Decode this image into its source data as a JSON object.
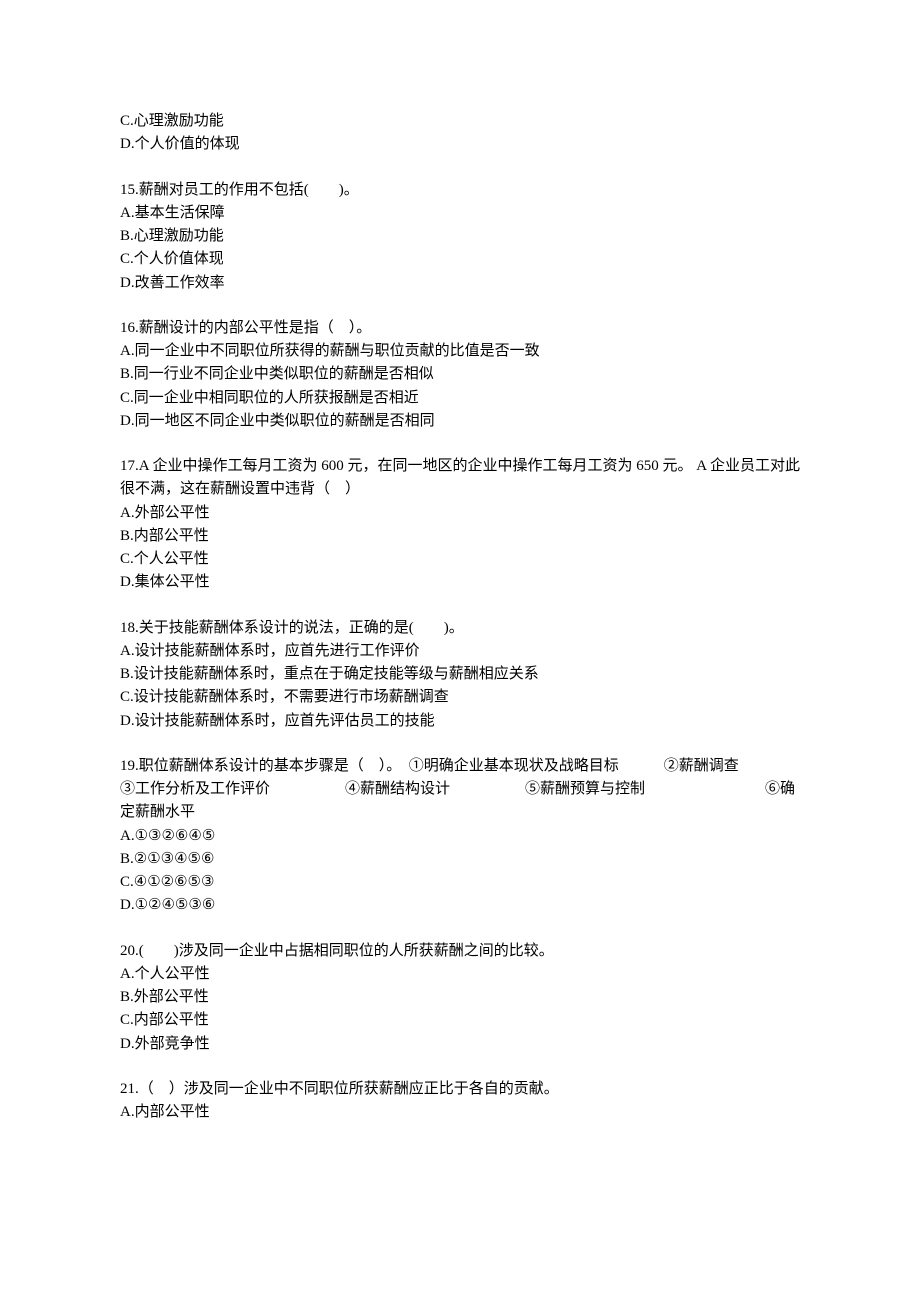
{
  "orphan": {
    "c": "C.心理激励功能",
    "d": "D.个人价值的体现"
  },
  "q15": {
    "stem": "15.薪酬对员工的作用不包括(　　)。",
    "a": "A.基本生活保障",
    "b": "B.心理激励功能",
    "c": "C.个人价值体现",
    "d": "D.改善工作效率"
  },
  "q16": {
    "stem": "16.薪酬设计的内部公平性是指（　）。",
    "a": "A.同一企业中不同职位所获得的薪酬与职位贡献的比值是否一致",
    "b": "B.同一行业不同企业中类似职位的薪酬是否相似",
    "c": "C.同一企业中相同职位的人所获报酬是否相近",
    "d": "D.同一地区不同企业中类似职位的薪酬是否相同"
  },
  "q17": {
    "stem": "17.A 企业中操作工每月工资为 600 元，在同一地区的企业中操作工每月工资为 650 元。 A 企业员工对此很不满，这在薪酬设置中违背（　）",
    "a": "A.外部公平性",
    "b": "B.内部公平性",
    "c": "C.个人公平性",
    "d": "D.集体公平性"
  },
  "q18": {
    "stem": "18.关于技能薪酬体系设计的说法，正确的是(　　)。",
    "a": "A.设计技能薪酬体系时，应首先进行工作评价",
    "b": "B.设计技能薪酬体系时，重点在于确定技能等级与薪酬相应关系",
    "c": "C.设计技能薪酬体系时，不需要进行市场薪酬调查",
    "d": "D.设计技能薪酬体系时，应首先评估员工的技能"
  },
  "q19": {
    "stem": "19.职位薪酬体系设计的基本步骤是（　）。　①明确企业基本现状及战略目标　　　②薪酬调查　　　　③工作分析及工作评价　　　　　④薪酬结构设计　　　　　⑤薪酬预算与控制　　　　　　　　⑥确定薪酬水平",
    "a": "A.①③②⑥④⑤",
    "b": "B.②①③④⑤⑥",
    "c": "C.④①②⑥⑤③",
    "d": "D.①②④⑤③⑥"
  },
  "q20": {
    "stem": "20.(　　)涉及同一企业中占据相同职位的人所获薪酬之间的比较。",
    "a": "A.个人公平性",
    "b": "B.外部公平性",
    "c": "C.内部公平性",
    "d": "D.外部竞争性"
  },
  "q21": {
    "stem": "21.（　）涉及同一企业中不同职位所获薪酬应正比于各自的贡献。",
    "a": "A.内部公平性"
  }
}
